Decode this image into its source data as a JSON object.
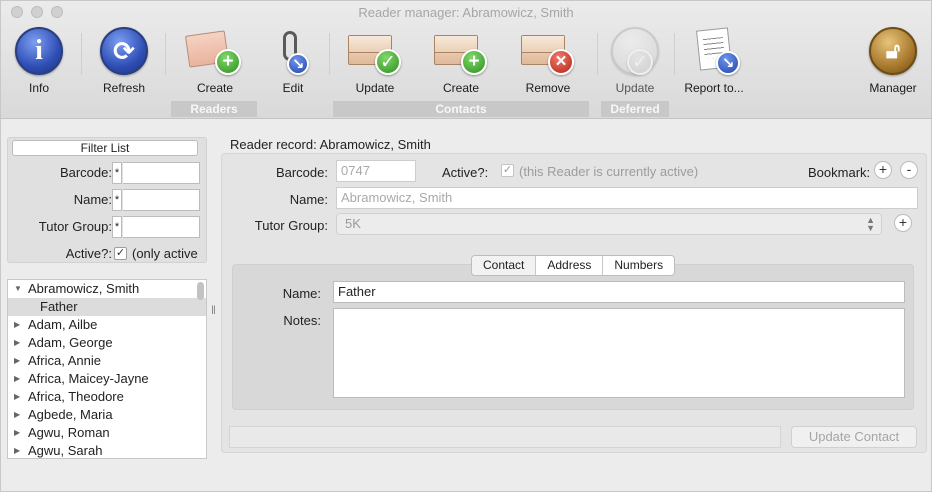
{
  "window": {
    "title": "Reader manager: Abramowicz, Smith"
  },
  "toolbar": {
    "info": "Info",
    "refresh": "Refresh",
    "create_reader": "Create",
    "edit": "Edit",
    "update_contact": "Update",
    "create_contact": "Create",
    "remove_contact": "Remove",
    "update_deferred": "Update",
    "report": "Report to...",
    "manager": "Manager",
    "groups": {
      "readers": "Readers",
      "contacts": "Contacts",
      "deferred": "Deferred"
    }
  },
  "filter": {
    "button": "Filter List",
    "barcode_label": "Barcode:",
    "barcode_value": "*",
    "name_label": "Name:",
    "name_value": "*",
    "tutor_label": "Tutor Group:",
    "tutor_value": "*",
    "active_label": "Active?:",
    "active_text": "(only active",
    "active_checked": "✓"
  },
  "list": {
    "items": [
      {
        "name": "Abramowicz, Smith",
        "expanded": true
      },
      {
        "name": "Father",
        "child": true
      },
      {
        "name": "Adam,  Ailbe"
      },
      {
        "name": "Adam,  George"
      },
      {
        "name": "Africa,  Annie"
      },
      {
        "name": "Africa,  Maicey-Jayne"
      },
      {
        "name": "Africa,  Theodore"
      },
      {
        "name": "Agbede,  Maria"
      },
      {
        "name": "Agwu,  Roman"
      },
      {
        "name": "Agwu,  Sarah"
      }
    ]
  },
  "record": {
    "title": "Reader record: Abramowicz, Smith",
    "barcode_label": "Barcode:",
    "barcode_value": "0747",
    "active_label": "Active?:",
    "active_checked": "✓",
    "active_text": "(this Reader is currently active)",
    "bookmark_label": "Bookmark:",
    "plus": "+",
    "minus": "-",
    "name_label": "Name:",
    "name_value": "Abramowicz, Smith",
    "tutor_label": "Tutor Group:",
    "tutor_value": "5K",
    "tabs": [
      "Contact",
      "Address",
      "Numbers"
    ],
    "contact": {
      "name_label": "Name:",
      "name_value": "Father",
      "notes_label": "Notes:",
      "notes_value": ""
    },
    "update_button": "Update Contact"
  }
}
